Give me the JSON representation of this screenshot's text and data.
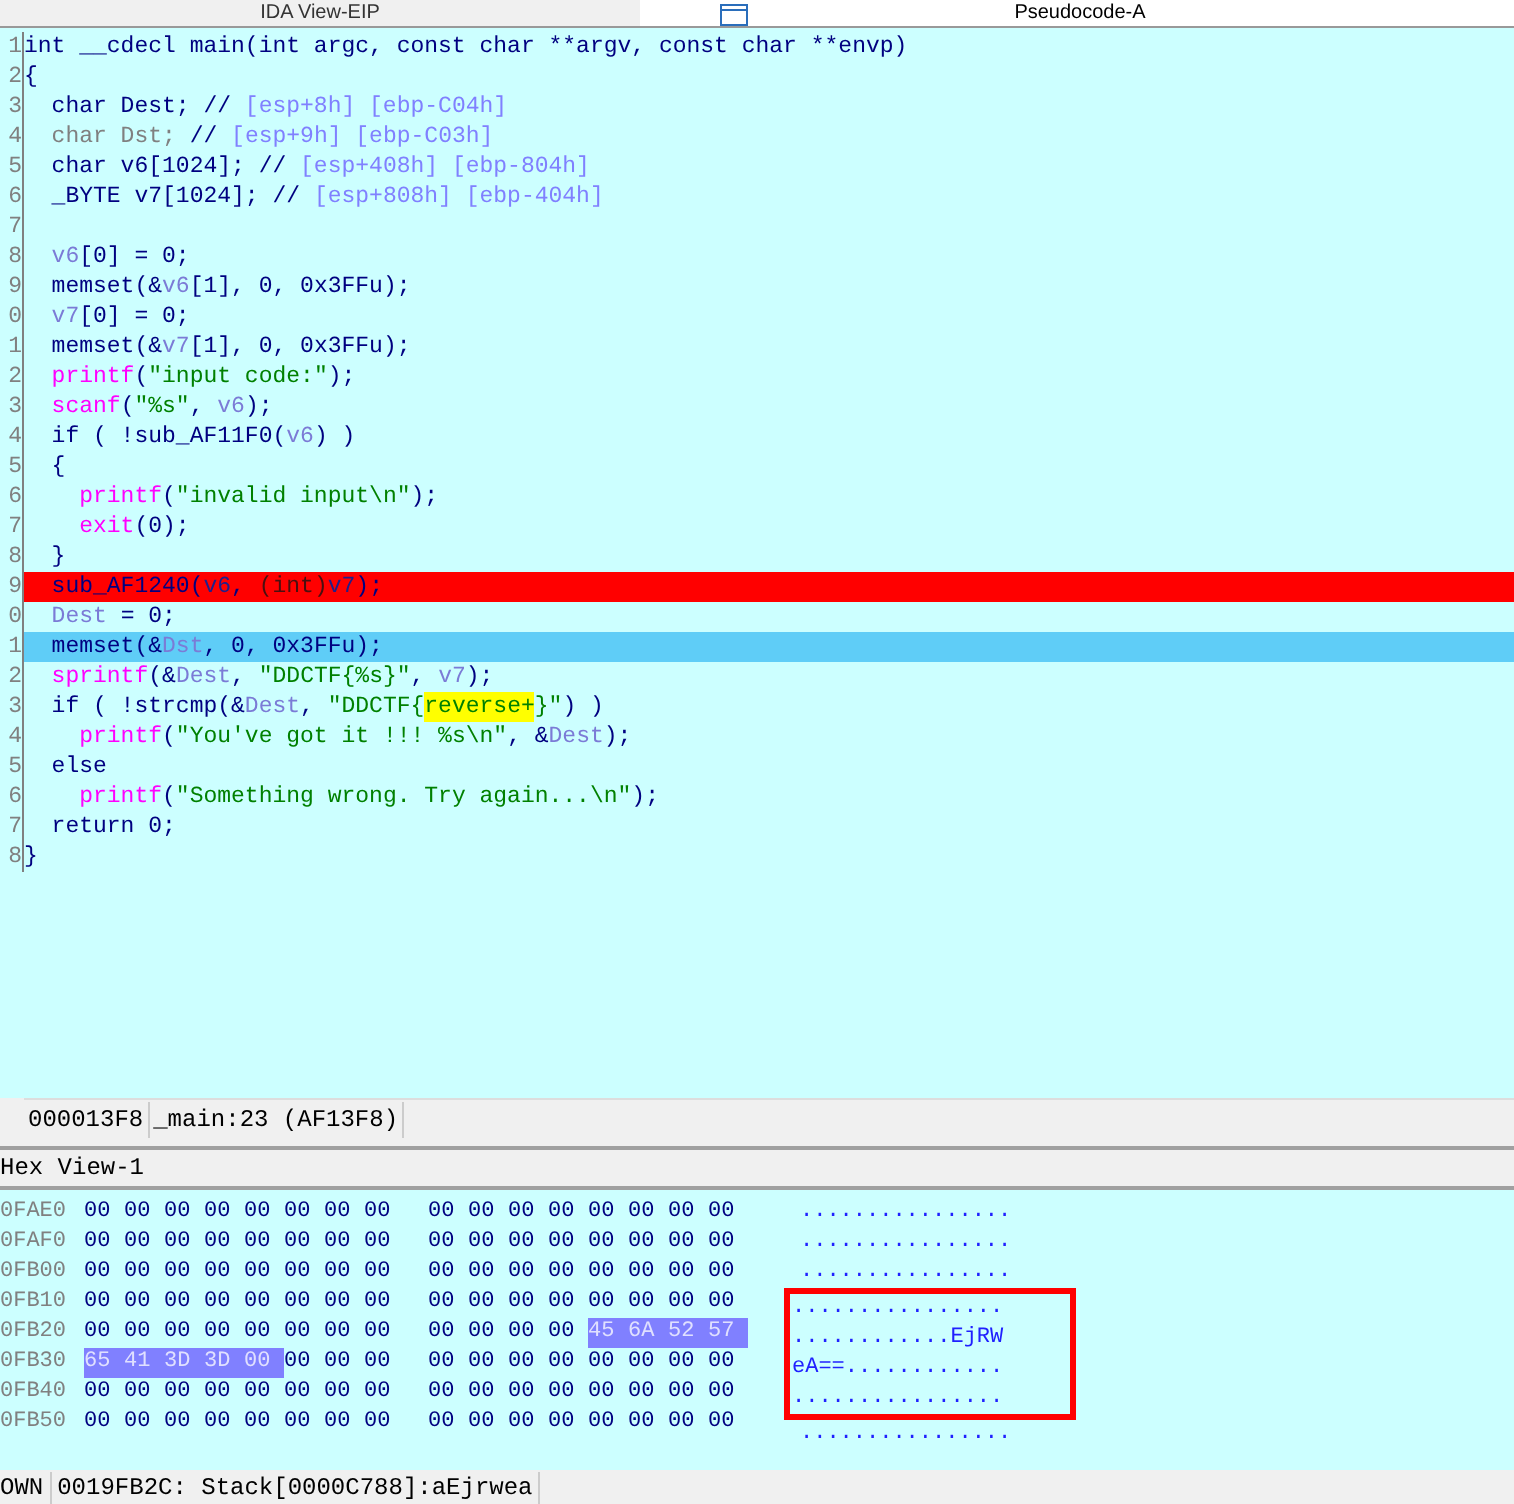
{
  "tabs": [
    {
      "label": "IDA View-EIP",
      "selected": false
    },
    {
      "label": "Pseudocode-A",
      "selected": true
    }
  ],
  "code": {
    "lines": [
      {
        "number": "1",
        "breakpoint": false,
        "current": false,
        "tokens": [
          {
            "text": "int __cdecl main(int argc, const char **argv, const char **envp)",
            "kind": "plain"
          }
        ]
      },
      {
        "number": "2",
        "breakpoint": false,
        "current": false,
        "tokens": [
          {
            "text": "{",
            "kind": "plain"
          }
        ]
      },
      {
        "number": "3",
        "breakpoint": false,
        "current": false,
        "tokens": [
          {
            "text": "  char Dest; // ",
            "kind": "plain"
          },
          {
            "text": "[esp+8h] [ebp-C04h]",
            "kind": "comment"
          }
        ]
      },
      {
        "number": "4",
        "breakpoint": false,
        "current": false,
        "tokens": [
          {
            "text": "  char Dst; ",
            "kind": "dim"
          },
          {
            "text": "// ",
            "kind": "plain"
          },
          {
            "text": "[esp+9h] [ebp-C03h]",
            "kind": "comment"
          }
        ]
      },
      {
        "number": "5",
        "breakpoint": false,
        "current": false,
        "tokens": [
          {
            "text": "  char v6[1024]; // ",
            "kind": "plain"
          },
          {
            "text": "[esp+408h] [ebp-804h]",
            "kind": "comment"
          }
        ]
      },
      {
        "number": "6",
        "breakpoint": false,
        "current": false,
        "tokens": [
          {
            "text": "  _BYTE v7[1024]; // ",
            "kind": "plain"
          },
          {
            "text": "[esp+808h] [ebp-404h]",
            "kind": "comment"
          }
        ]
      },
      {
        "number": "7",
        "breakpoint": false,
        "current": false
      },
      {
        "number": "8",
        "breakpoint": false,
        "current": false,
        "tokens": [
          {
            "text": "  v6",
            "kind": "var"
          },
          {
            "text": "[0] = 0;",
            "kind": "plain"
          }
        ]
      },
      {
        "number": "9",
        "breakpoint": false,
        "current": false,
        "tokens": [
          {
            "text": "  memset(&",
            "kind": "plain"
          },
          {
            "text": "v6",
            "kind": "var"
          },
          {
            "text": "[1], 0, 0x3FFu);",
            "kind": "plain"
          }
        ]
      },
      {
        "number": "0",
        "breakpoint": false,
        "current": false,
        "tokens": [
          {
            "text": "  v7",
            "kind": "var"
          },
          {
            "text": "[0] = 0;",
            "kind": "plain"
          }
        ]
      },
      {
        "number": "1",
        "breakpoint": false,
        "current": false,
        "tokens": [
          {
            "text": "  memset(&",
            "kind": "plain"
          },
          {
            "text": "v7",
            "kind": "var"
          },
          {
            "text": "[1], 0, 0x3FFu);",
            "kind": "plain"
          }
        ]
      },
      {
        "number": "2",
        "breakpoint": false,
        "current": false,
        "tokens": [
          {
            "text": "  printf",
            "kind": "func"
          },
          {
            "text": "(",
            "kind": "plain"
          },
          {
            "text": "\"input code:\"",
            "kind": "string"
          },
          {
            "text": ");",
            "kind": "plain"
          }
        ]
      },
      {
        "number": "3",
        "breakpoint": false,
        "current": false,
        "tokens": [
          {
            "text": "  scanf",
            "kind": "func"
          },
          {
            "text": "(",
            "kind": "plain"
          },
          {
            "text": "\"%s\"",
            "kind": "string"
          },
          {
            "text": ", ",
            "kind": "plain"
          },
          {
            "text": "v6",
            "kind": "var"
          },
          {
            "text": ");",
            "kind": "plain"
          }
        ]
      },
      {
        "number": "4",
        "breakpoint": false,
        "current": false,
        "tokens": [
          {
            "text": "  if ( !sub_AF11F0(",
            "kind": "plain"
          },
          {
            "text": "v6",
            "kind": "var"
          },
          {
            "text": ") )",
            "kind": "plain"
          }
        ]
      },
      {
        "number": "5",
        "breakpoint": false,
        "current": false,
        "tokens": [
          {
            "text": "  {",
            "kind": "plain"
          }
        ]
      },
      {
        "number": "6",
        "breakpoint": false,
        "current": false,
        "tokens": [
          {
            "text": "    printf",
            "kind": "func"
          },
          {
            "text": "(",
            "kind": "plain"
          },
          {
            "text": "\"invalid input\\n\"",
            "kind": "string"
          },
          {
            "text": ");",
            "kind": "plain"
          }
        ]
      },
      {
        "number": "7",
        "breakpoint": false,
        "current": false,
        "tokens": [
          {
            "text": "    exit",
            "kind": "func"
          },
          {
            "text": "(0);",
            "kind": "plain"
          }
        ]
      },
      {
        "number": "8",
        "breakpoint": false,
        "current": false,
        "tokens": [
          {
            "text": "  }",
            "kind": "plain"
          }
        ]
      },
      {
        "number": "9",
        "breakpoint": true,
        "current": false,
        "tokens": [
          {
            "text": "  sub_AF1240(",
            "kind": "plain"
          },
          {
            "text": "v6",
            "kind": "var"
          },
          {
            "text": ", ",
            "kind": "plain"
          },
          {
            "text": "(int)",
            "kind": "dim"
          },
          {
            "text": "v7",
            "kind": "var"
          },
          {
            "text": ");",
            "kind": "plain"
          }
        ]
      },
      {
        "number": "0",
        "breakpoint": false,
        "current": false,
        "tokens": [
          {
            "text": "  Dest",
            "kind": "var"
          },
          {
            "text": " = 0;",
            "kind": "plain"
          }
        ]
      },
      {
        "number": "1",
        "breakpoint": false,
        "current": true,
        "tokens": [
          {
            "text": "  memset(&",
            "kind": "plain"
          },
          {
            "text": "Dst",
            "kind": "var"
          },
          {
            "text": ", 0, 0x3FFu);",
            "kind": "plain"
          }
        ]
      },
      {
        "number": "2",
        "breakpoint": false,
        "current": false,
        "tokens": [
          {
            "text": "  sprintf",
            "kind": "func"
          },
          {
            "text": "(&",
            "kind": "plain"
          },
          {
            "text": "Dest",
            "kind": "var"
          },
          {
            "text": ", ",
            "kind": "plain"
          },
          {
            "text": "\"DDCTF{%s}\"",
            "kind": "string"
          },
          {
            "text": ", ",
            "kind": "plain"
          },
          {
            "text": "v7",
            "kind": "var"
          },
          {
            "text": ");",
            "kind": "plain"
          }
        ]
      },
      {
        "number": "3",
        "breakpoint": false,
        "current": false,
        "tokens": [
          {
            "text": "  if ( !strcmp(&",
            "kind": "plain"
          },
          {
            "text": "Dest",
            "kind": "var"
          },
          {
            "text": ", ",
            "kind": "plain"
          },
          {
            "text": "\"DDCTF{",
            "kind": "string"
          },
          {
            "text": "reverse+",
            "kind": "match"
          },
          {
            "text": "}\"",
            "kind": "string"
          },
          {
            "text": ") )",
            "kind": "plain"
          }
        ]
      },
      {
        "number": "4",
        "breakpoint": false,
        "current": false,
        "tokens": [
          {
            "text": "    printf",
            "kind": "func"
          },
          {
            "text": "(",
            "kind": "plain"
          },
          {
            "text": "\"You've got it !!! %s\\n\"",
            "kind": "string"
          },
          {
            "text": ", &",
            "kind": "plain"
          },
          {
            "text": "Dest",
            "kind": "var"
          },
          {
            "text": ");",
            "kind": "plain"
          }
        ]
      },
      {
        "number": "5",
        "breakpoint": false,
        "current": false,
        "tokens": [
          {
            "text": "  else",
            "kind": "plain"
          }
        ]
      },
      {
        "number": "6",
        "breakpoint": false,
        "current": false,
        "tokens": [
          {
            "text": "    printf",
            "kind": "func"
          },
          {
            "text": "(",
            "kind": "plain"
          },
          {
            "text": "\"Something wrong. Try again...\\n\"",
            "kind": "string"
          },
          {
            "text": ");",
            "kind": "plain"
          }
        ]
      },
      {
        "number": "7",
        "breakpoint": false,
        "current": false,
        "tokens": [
          {
            "text": "  return 0;",
            "kind": "plain"
          }
        ]
      },
      {
        "number": "8",
        "breakpoint": false,
        "current": false,
        "tokens": [
          {
            "text": "}",
            "kind": "plain"
          }
        ]
      }
    ]
  },
  "code_status": [
    "000013F8",
    "_main:23 (AF13F8)"
  ],
  "hex_view": {
    "title": "Hex View-1",
    "rows": [
      {
        "address": "0FAE0",
        "bytes": [
          "00",
          "00",
          "00",
          "00",
          "00",
          "00",
          "00",
          "00",
          "00",
          "00",
          "00",
          "00",
          "00",
          "00",
          "00",
          "00"
        ],
        "selected": [
          false,
          false,
          false,
          false,
          false,
          false,
          false,
          false,
          false,
          false,
          false,
          false,
          false,
          false,
          false,
          false
        ],
        "ascii": "................",
        "boxed": false
      },
      {
        "address": "0FAF0",
        "bytes": [
          "00",
          "00",
          "00",
          "00",
          "00",
          "00",
          "00",
          "00",
          "00",
          "00",
          "00",
          "00",
          "00",
          "00",
          "00",
          "00"
        ],
        "selected": [
          false,
          false,
          false,
          false,
          false,
          false,
          false,
          false,
          false,
          false,
          false,
          false,
          false,
          false,
          false,
          false
        ],
        "ascii": "................",
        "boxed": false
      },
      {
        "address": "0FB00",
        "bytes": [
          "00",
          "00",
          "00",
          "00",
          "00",
          "00",
          "00",
          "00",
          "00",
          "00",
          "00",
          "00",
          "00",
          "00",
          "00",
          "00"
        ],
        "selected": [
          false,
          false,
          false,
          false,
          false,
          false,
          false,
          false,
          false,
          false,
          false,
          false,
          false,
          false,
          false,
          false
        ],
        "ascii": "................",
        "boxed": false
      },
      {
        "address": "0FB10",
        "bytes": [
          "00",
          "00",
          "00",
          "00",
          "00",
          "00",
          "00",
          "00",
          "00",
          "00",
          "00",
          "00",
          "00",
          "00",
          "00",
          "00"
        ],
        "selected": [
          false,
          false,
          false,
          false,
          false,
          false,
          false,
          false,
          false,
          false,
          false,
          false,
          false,
          false,
          false,
          false
        ],
        "ascii": "................",
        "boxed": true
      },
      {
        "address": "0FB20",
        "bytes": [
          "00",
          "00",
          "00",
          "00",
          "00",
          "00",
          "00",
          "00",
          "00",
          "00",
          "00",
          "00",
          "45",
          "6A",
          "52",
          "57"
        ],
        "selected": [
          false,
          false,
          false,
          false,
          false,
          false,
          false,
          false,
          false,
          false,
          false,
          false,
          true,
          true,
          true,
          true
        ],
        "ascii": "............EjRW",
        "boxed": true
      },
      {
        "address": "0FB30",
        "bytes": [
          "65",
          "41",
          "3D",
          "3D",
          "00",
          "00",
          "00",
          "00",
          "00",
          "00",
          "00",
          "00",
          "00",
          "00",
          "00",
          "00"
        ],
        "selected": [
          true,
          true,
          true,
          true,
          true,
          false,
          false,
          false,
          false,
          false,
          false,
          false,
          false,
          false,
          false,
          false
        ],
        "ascii": "eA==............",
        "boxed": true
      },
      {
        "address": "0FB40",
        "bytes": [
          "00",
          "00",
          "00",
          "00",
          "00",
          "00",
          "00",
          "00",
          "00",
          "00",
          "00",
          "00",
          "00",
          "00",
          "00",
          "00"
        ],
        "selected": [
          false,
          false,
          false,
          false,
          false,
          false,
          false,
          false,
          false,
          false,
          false,
          false,
          false,
          false,
          false,
          false
        ],
        "ascii": "................",
        "boxed": true
      },
      {
        "address": "0FB50",
        "bytes": [
          "00",
          "00",
          "00",
          "00",
          "00",
          "00",
          "00",
          "00",
          "00",
          "00",
          "00",
          "00",
          "00",
          "00",
          "00",
          "00"
        ],
        "selected": [
          false,
          false,
          false,
          false,
          false,
          false,
          false,
          false,
          false,
          false,
          false,
          false,
          false,
          false,
          false,
          false
        ],
        "ascii": "................",
        "boxed": false
      }
    ]
  },
  "hex_status": [
    "OWN",
    "0019FB2C: Stack[0000C788]:aEjrwea"
  ]
}
